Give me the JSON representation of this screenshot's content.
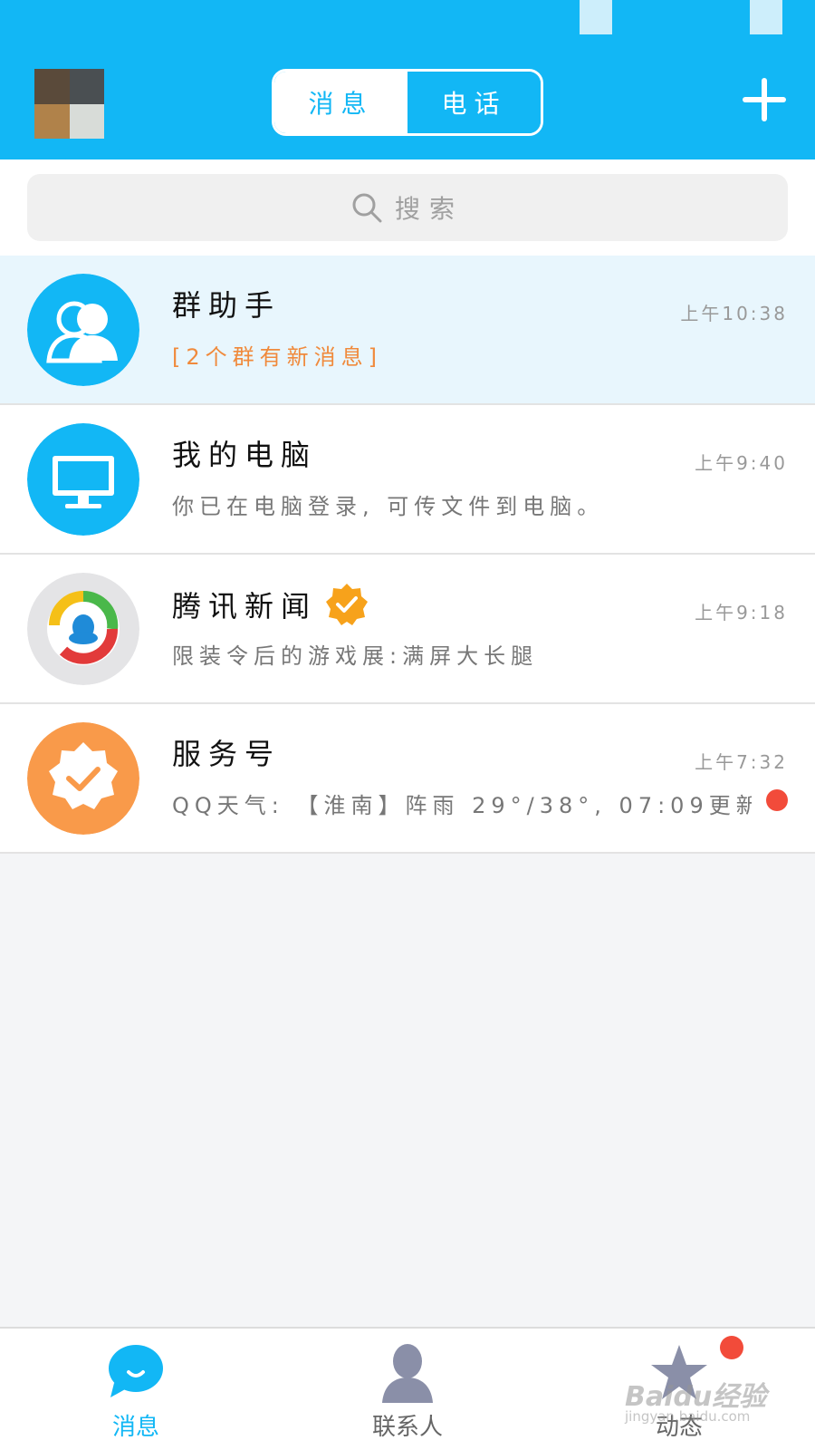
{
  "colors": {
    "brand_blue": "#12b7f5",
    "highlight_row": "#e8f6fd",
    "orange": "#f08a3c",
    "unread_red": "#f24b3a",
    "verified_orange": "#f7a21b",
    "service_orange": "#f99a4a"
  },
  "header": {
    "avatar_icon": "user-avatar",
    "tabs": [
      {
        "label": "消息",
        "active": true
      },
      {
        "label": "电话",
        "active": false
      }
    ],
    "add_icon": "plus-icon"
  },
  "search": {
    "placeholder": "搜索",
    "icon": "search-icon"
  },
  "conversations": [
    {
      "title": "群助手",
      "preview": "[2个群有新消息]",
      "time": "上午10:38",
      "icon": "group-assistant-icon"
    },
    {
      "title": "我的电脑",
      "preview": "你已在电脑登录, 可传文件到电脑。",
      "time": "上午9:40",
      "icon": "computer-icon"
    },
    {
      "title": "腾讯新闻",
      "preview": "限装令后的游戏展:满屏大长腿",
      "time": "上午9:18",
      "icon": "tencent-news-icon",
      "verified": true
    },
    {
      "title": "服务号",
      "preview": "QQ天气: 【淮南】阵雨 29°/38°, 07:09更新",
      "time": "上午7:32",
      "icon": "service-account-icon",
      "unread": true
    }
  ],
  "bottom_nav": [
    {
      "label": "消息",
      "icon": "chat-bubble-icon",
      "active": true
    },
    {
      "label": "联系人",
      "icon": "contacts-icon",
      "active": false
    },
    {
      "label": "动态",
      "icon": "star-icon",
      "active": false,
      "badge": true
    }
  ],
  "watermark": {
    "text": "Baidu经验",
    "sub": "jingyan.baidu.com"
  }
}
